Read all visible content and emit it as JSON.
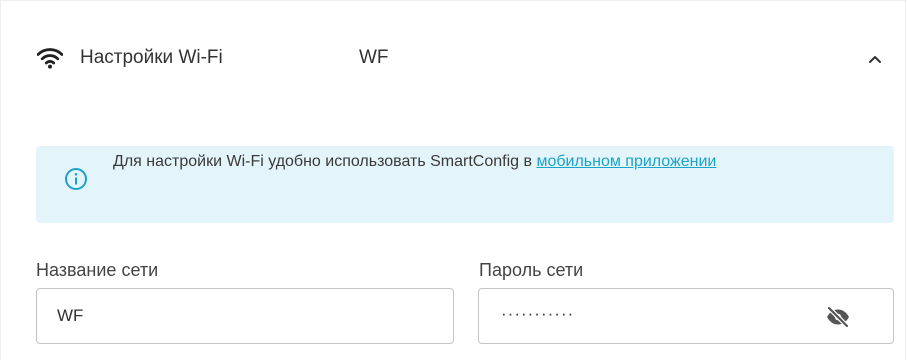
{
  "section": {
    "title": "Настройки Wi-Fi",
    "current_network": "WF",
    "expanded": true,
    "icons": {
      "wifi": "wifi-icon",
      "collapse": "chevron-up-icon"
    }
  },
  "info": {
    "icon": "info-circle-icon",
    "text_before_link": "Для настройки Wi-Fi удобно использовать SmartConfig в ",
    "link_text": "мобильном приложении",
    "colors": {
      "background": "#e3f5fa",
      "icon": "#1ba3c7",
      "link": "#1ba3c7"
    }
  },
  "form": {
    "ssid": {
      "label": "Название сети",
      "value": "WF"
    },
    "password": {
      "label": "Пароль сети",
      "masked_value": "···········",
      "visibility_icon": "eye-off-icon"
    }
  }
}
